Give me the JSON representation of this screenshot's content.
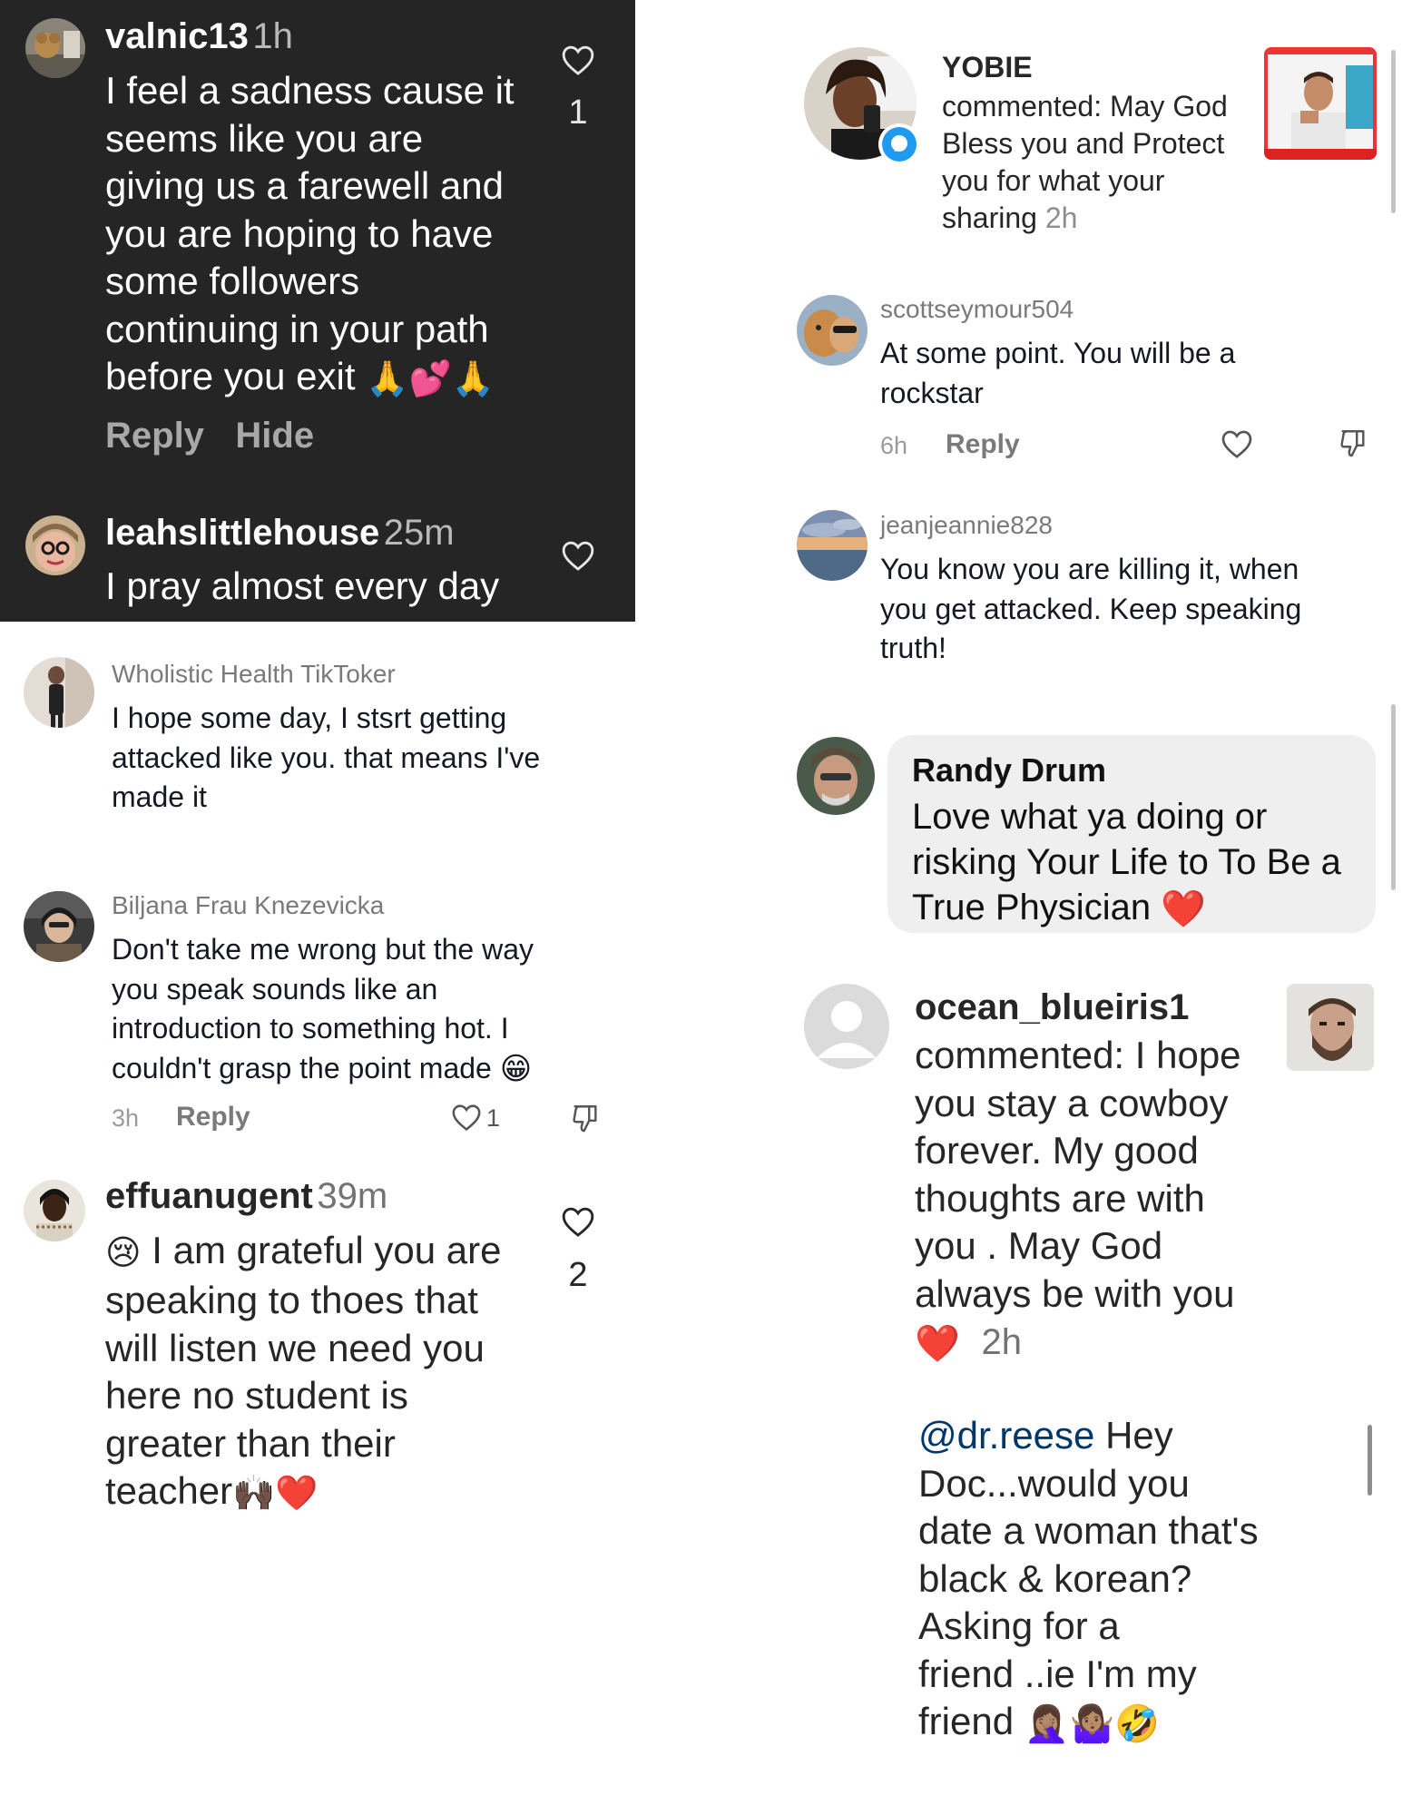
{
  "colors": {
    "dark_bg": "#252525",
    "heart_red": "#e8202f",
    "link_blue": "#00376b",
    "bubble_bg": "#efefef"
  },
  "panel_valnic": {
    "username": "valnic13",
    "time": "1h",
    "lines": [
      "I feel a sadness cause it",
      "seems like you are",
      "giving us a farewell and",
      "you are hoping to have",
      "some followers",
      "continuing in your path",
      "before you exit"
    ],
    "emojis": [
      "🙏",
      "💕",
      "🙏"
    ],
    "like_count": "1",
    "reply_label": "Reply",
    "hide_label": "Hide",
    "heart_icon": "heart-outline-icon"
  },
  "panel_leah": {
    "username": "leahslittlehouse",
    "time": "25m",
    "text": "I pray almost every day"
  },
  "panel_wholistic": {
    "username": "Wholistic Health TikToker",
    "lines": [
      "I hope some day, I stsrt getting",
      "attacked like you. that means I've",
      "made it"
    ]
  },
  "panel_biljana": {
    "username": "Biljana Frau Knezevicka",
    "lines": [
      "Don't take me wrong but the way",
      "you speak sounds like an",
      "introduction to something hot. I",
      "couldn't grasp the point made"
    ],
    "emoji": "😁",
    "time": "3h",
    "reply_label": "Reply",
    "like_count": "1",
    "dislike_icon": "dislike-icon"
  },
  "panel_effua": {
    "username": "effuanugent",
    "time": "39m",
    "lines": [
      "I am grateful you are",
      "speaking to thoes that",
      "will listen we need you",
      "here no student is",
      "greater than their",
      "teacher"
    ],
    "first_emoji": "😢",
    "end_emojis": [
      "🙌🏿",
      "❤️"
    ],
    "like_count": "2"
  },
  "panel_yobie": {
    "username": "YOBIE",
    "lines": [
      "commented: May God",
      "Bless you and Protect",
      "you for what your",
      "sharing"
    ],
    "time": "2h"
  },
  "panel_scott": {
    "username": "scottseymour504",
    "lines": [
      "At some point. You will be a",
      "rockstar"
    ],
    "time": "6h",
    "reply_label": "Reply"
  },
  "panel_jean": {
    "username": "jeanjeannie828",
    "lines": [
      "You know you are killing it, when",
      "you get attacked. Keep speaking",
      "truth!"
    ]
  },
  "panel_randy": {
    "username": "Randy Drum",
    "lines": [
      "Love what ya doing or",
      "risking Your Life to To Be a",
      "True Physician"
    ],
    "emoji": "❤️"
  },
  "panel_ocean": {
    "username": "ocean_blueiris1",
    "lines": [
      "commented: I hope",
      "you stay a cowboy",
      "forever. My good",
      "thoughts are with",
      "you .  May God",
      "always be with you"
    ],
    "emoji": "❤️",
    "time": "2h"
  },
  "panel_reese": {
    "mention": "@dr.reese",
    "first_rest": " Hey",
    "lines": [
      "Doc...would you",
      "date a woman that's",
      "black & korean?",
      "Asking for a",
      "friend ..ie I'm my"
    ],
    "last_word": "friend",
    "emojis": [
      "🤦🏽‍♀️",
      "🤷🏽‍♀️",
      "🤣"
    ]
  }
}
